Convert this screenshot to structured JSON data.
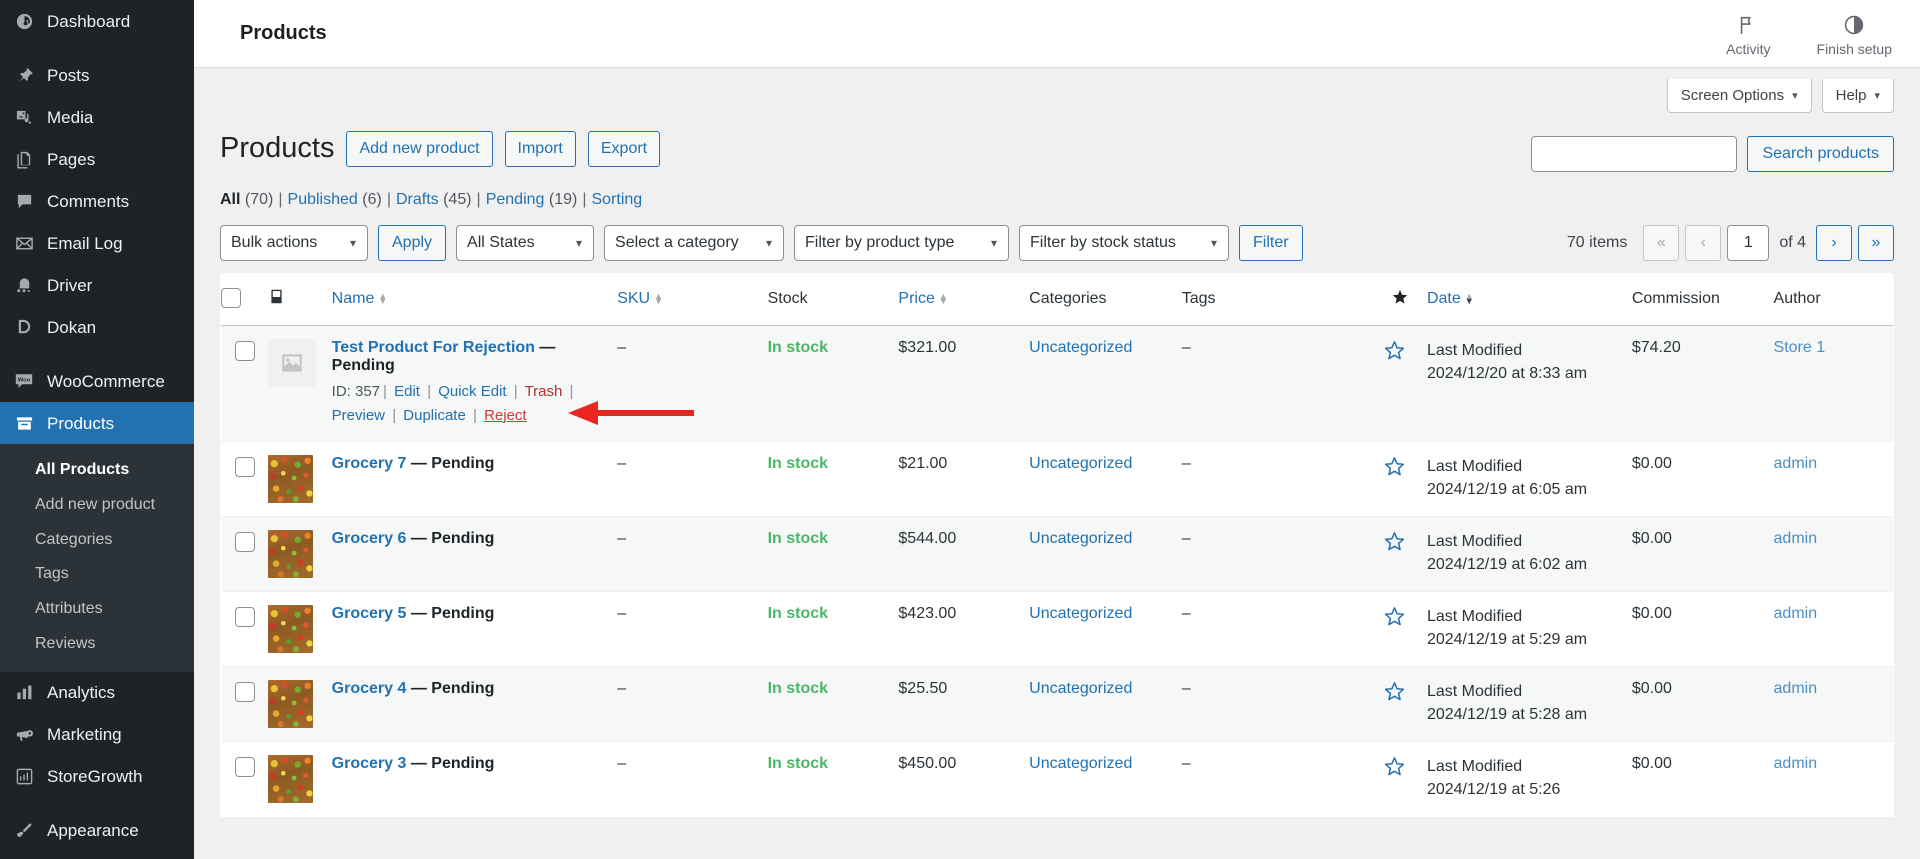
{
  "sidebar": {
    "items": [
      {
        "label": "Dashboard",
        "icon": "dashboard-icon",
        "gap_after": true
      },
      {
        "label": "Posts",
        "icon": "pin-icon"
      },
      {
        "label": "Media",
        "icon": "media-icon"
      },
      {
        "label": "Pages",
        "icon": "pages-icon"
      },
      {
        "label": "Comments",
        "icon": "comment-icon"
      },
      {
        "label": "Email Log",
        "icon": "envelope-icon"
      },
      {
        "label": "Driver",
        "icon": "driver-icon"
      },
      {
        "label": "Dokan",
        "icon": "dokan-icon",
        "gap_after": true
      },
      {
        "label": "WooCommerce",
        "icon": "woo-icon"
      },
      {
        "label": "Products",
        "icon": "products-icon",
        "current": true
      },
      {
        "label": "Analytics",
        "icon": "analytics-icon"
      },
      {
        "label": "Marketing",
        "icon": "megaphone-icon"
      },
      {
        "label": "StoreGrowth",
        "icon": "storegrowth-icon",
        "gap_after": true
      },
      {
        "label": "Appearance",
        "icon": "brush-icon"
      }
    ],
    "submenu": [
      {
        "label": "All Products",
        "active": true
      },
      {
        "label": "Add new product"
      },
      {
        "label": "Categories"
      },
      {
        "label": "Tags"
      },
      {
        "label": "Attributes"
      },
      {
        "label": "Reviews"
      }
    ]
  },
  "topbar": {
    "title": "Products",
    "activity_label": "Activity",
    "activity_icon": "flag-icon",
    "finish_setup_label": "Finish setup",
    "finish_setup_icon": "half-circle-icon"
  },
  "screen_options": {
    "screen_options_label": "Screen Options",
    "help_label": "Help",
    "caret": "▾"
  },
  "page": {
    "heading": "Products",
    "buttons": [
      {
        "label": "Add new product",
        "name": "add-new-product-button"
      },
      {
        "label": "Import",
        "name": "import-button"
      },
      {
        "label": "Export",
        "name": "export-button"
      }
    ]
  },
  "status_filters": [
    {
      "label": "All",
      "count": "(70)",
      "current": true
    },
    {
      "label": "Published",
      "count": "(6)"
    },
    {
      "label": "Drafts",
      "count": "(45)"
    },
    {
      "label": "Pending",
      "count": "(19)"
    },
    {
      "label": "Sorting",
      "count": ""
    }
  ],
  "search": {
    "value": "",
    "placeholder": "",
    "button_label": "Search products"
  },
  "tablenav": {
    "bulk_actions_label": "Bulk actions",
    "apply_label": "Apply",
    "all_states_label": "All States",
    "select_category_label": "Select a category",
    "product_type_label": "Filter by product type",
    "stock_status_label": "Filter by stock status",
    "filter_label": "Filter",
    "items_count": "70 items",
    "first_page": "«",
    "prev_page": "‹",
    "current_page": "1",
    "of_label": "of 4",
    "next_page": "›",
    "last_page": "»"
  },
  "table": {
    "columns": [
      {
        "label": "",
        "name": "select-all-column",
        "key": "cb"
      },
      {
        "label": "",
        "name": "image-column",
        "key": "img"
      },
      {
        "label": "Name",
        "name": "name-column",
        "sortable": true,
        "key": "name"
      },
      {
        "label": "SKU",
        "name": "sku-column",
        "sortable": true,
        "key": "sku"
      },
      {
        "label": "Stock",
        "name": "stock-column",
        "key": "stock"
      },
      {
        "label": "Price",
        "name": "price-column",
        "sortable": true,
        "key": "price"
      },
      {
        "label": "Categories",
        "name": "categories-column",
        "key": "categories"
      },
      {
        "label": "Tags",
        "name": "tags-column",
        "key": "tags"
      },
      {
        "label": "★",
        "name": "featured-column",
        "key": "featured"
      },
      {
        "label": "Date",
        "name": "date-column",
        "sortable": true,
        "key": "date"
      },
      {
        "label": "Commission",
        "name": "commission-column",
        "key": "commission"
      },
      {
        "label": "Author",
        "name": "author-column",
        "key": "author"
      }
    ],
    "rows": [
      {
        "name": "Test Product For Rejection",
        "status": "— Pending",
        "has_thumb": false,
        "row_actions": {
          "id_label": "ID: 357",
          "links": [
            "Edit",
            "Quick Edit",
            "Trash",
            "Preview",
            "Duplicate",
            "Reject"
          ]
        },
        "sku": "–",
        "stock": "In stock",
        "price": "$321.00",
        "categories": "Uncategorized",
        "tags": "–",
        "date_label": "Last Modified",
        "date_value": "2024/12/20 at 8:33 am",
        "commission": "$74.20",
        "author": "Store 1"
      },
      {
        "name": "Grocery 7",
        "status": "— Pending",
        "has_thumb": true,
        "sku": "–",
        "stock": "In stock",
        "price": "$21.00",
        "categories": "Uncategorized",
        "tags": "–",
        "date_label": "Last Modified",
        "date_value": "2024/12/19 at 6:05 am",
        "commission": "$0.00",
        "author": "admin"
      },
      {
        "name": "Grocery 6",
        "status": "— Pending",
        "has_thumb": true,
        "sku": "–",
        "stock": "In stock",
        "price": "$544.00",
        "categories": "Uncategorized",
        "tags": "–",
        "date_label": "Last Modified",
        "date_value": "2024/12/19 at 6:02 am",
        "commission": "$0.00",
        "author": "admin"
      },
      {
        "name": "Grocery 5",
        "status": "— Pending",
        "has_thumb": true,
        "sku": "–",
        "stock": "In stock",
        "price": "$423.00",
        "categories": "Uncategorized",
        "tags": "–",
        "date_label": "Last Modified",
        "date_value": "2024/12/19 at 5:29 am",
        "commission": "$0.00",
        "author": "admin"
      },
      {
        "name": "Grocery 4",
        "status": "— Pending",
        "has_thumb": true,
        "sku": "–",
        "stock": "In stock",
        "price": "$25.50",
        "categories": "Uncategorized",
        "tags": "–",
        "date_label": "Last Modified",
        "date_value": "2024/12/19 at 5:28 am",
        "commission": "$0.00",
        "author": "admin"
      },
      {
        "name": "Grocery 3",
        "status": "— Pending",
        "has_thumb": true,
        "sku": "–",
        "stock": "In stock",
        "price": "$450.00",
        "categories": "Uncategorized",
        "tags": "–",
        "date_label": "Last Modified",
        "date_value": "2024/12/19 at 5:26",
        "commission": "$0.00",
        "author": "admin"
      }
    ]
  },
  "annotation": {
    "type": "arrow",
    "color": "#e8251e",
    "points_to": "Reject"
  },
  "colors": {
    "sidebar_bg": "#1d2327",
    "submenu_bg": "#2c3338",
    "accent_blue": "#2271b1",
    "in_stock_green": "#4ab866",
    "trash_red": "#b32d2e",
    "reject_red": "#d63638",
    "arrow_red": "#e8251e"
  }
}
